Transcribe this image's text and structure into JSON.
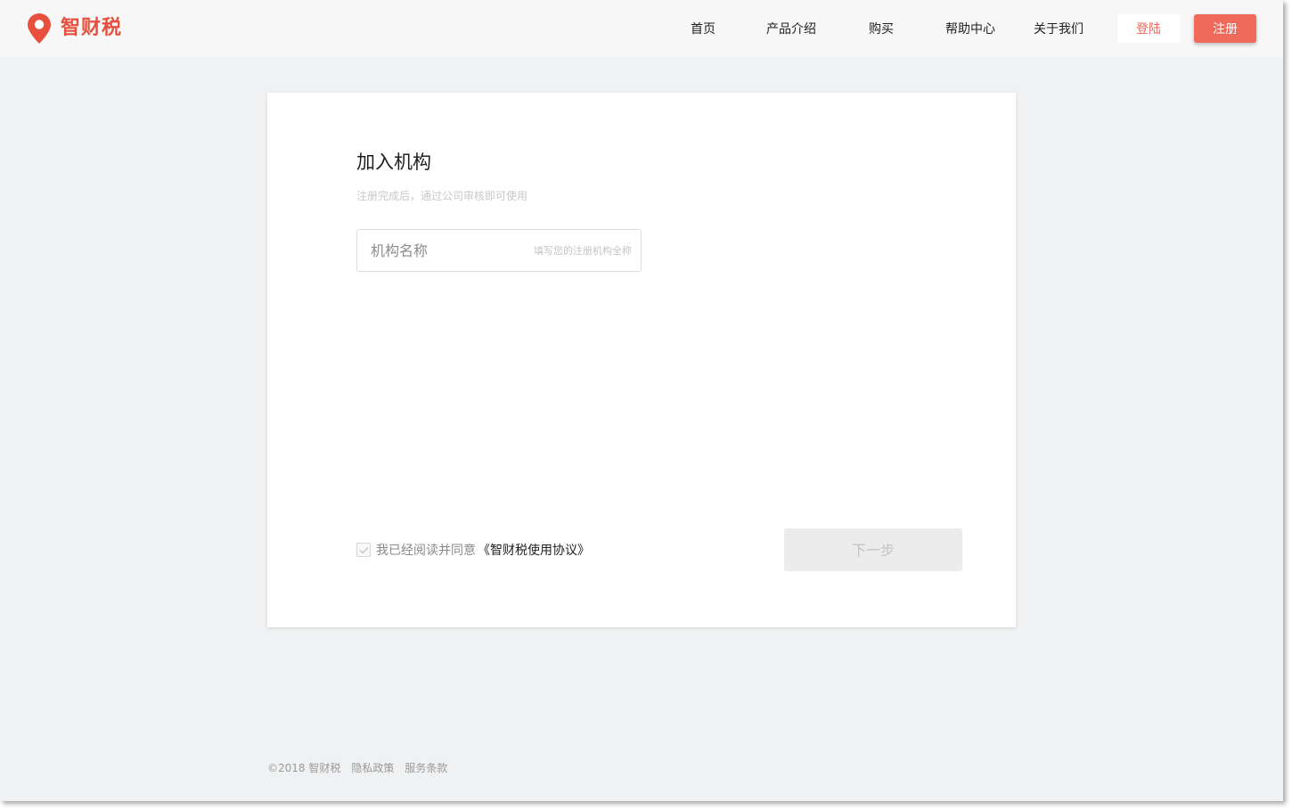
{
  "brand": {
    "name": "智财税",
    "color": "#e8503e",
    "icon": "location-pin-icon"
  },
  "nav": {
    "items": [
      {
        "label": "首页"
      },
      {
        "label": "产品介绍"
      },
      {
        "label": "购买"
      },
      {
        "label": "帮助中心"
      },
      {
        "label": "关于我们"
      }
    ],
    "login_label": "登陆",
    "register_label": "注册",
    "accent_color": "#f0695a"
  },
  "form": {
    "title": "加入机构",
    "subtitle": "注册完成后，通过公司审核即可使用",
    "org_field": {
      "label": "机构名称",
      "placeholder": "填写您的注册机构全称",
      "value": ""
    },
    "agree": {
      "checked": true,
      "text": "我已经阅读并同意",
      "link": "《智财税使用协议》"
    },
    "next_label": "下一步"
  },
  "footer": {
    "copyright": "©2018 智财税",
    "privacy": "隐私政策",
    "terms": "服务条款"
  }
}
